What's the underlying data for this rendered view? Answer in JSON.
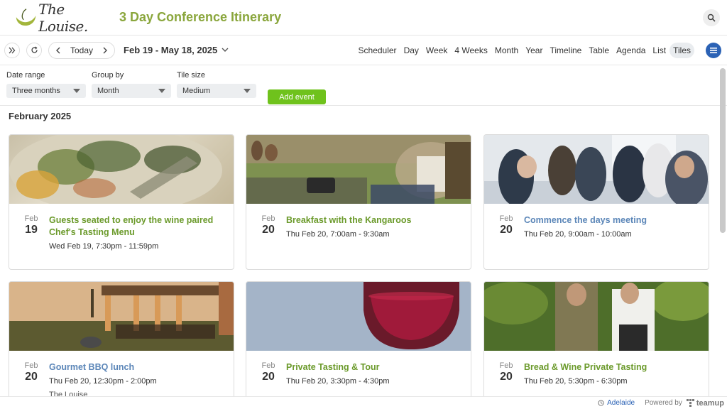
{
  "header": {
    "logo_text": "The Louise.",
    "title": "3 Day Conference Itinerary"
  },
  "toolbar": {
    "today_label": "Today",
    "date_range": "Feb 19 - May 18, 2025",
    "views": [
      "Scheduler",
      "Day",
      "Week",
      "4 Weeks",
      "Month",
      "Year",
      "Timeline",
      "Table",
      "Agenda",
      "List",
      "Tiles"
    ],
    "active_view": "Tiles"
  },
  "filters": {
    "date_range": {
      "label": "Date range",
      "value": "Three months"
    },
    "group_by": {
      "label": "Group by",
      "value": "Month"
    },
    "tile_size": {
      "label": "Tile size",
      "value": "Medium"
    },
    "add_event_label": "Add event"
  },
  "section_title": "February 2025",
  "events": [
    {
      "mon": "Feb",
      "day": "19",
      "title": "Guests seated to enjoy the wine paired Chef's Tasting Menu",
      "time": "Wed Feb 19, 7:30pm - 11:59pm",
      "location": "",
      "color": "#6b9a2b"
    },
    {
      "mon": "Feb",
      "day": "20",
      "title": "Breakfast with the Kangaroos",
      "time": "Thu Feb 20, 7:00am - 9:30am",
      "location": "",
      "color": "#6b9a2b"
    },
    {
      "mon": "Feb",
      "day": "20",
      "title": "Commence the days meeting",
      "time": "Thu Feb 20, 9:00am - 10:00am",
      "location": "",
      "color": "#5b86b8"
    },
    {
      "mon": "Feb",
      "day": "20",
      "title": "Gourmet BBQ lunch",
      "time": "Thu Feb 20, 12:30pm - 2:00pm",
      "location": "The Louise",
      "color": "#5b86b8"
    },
    {
      "mon": "Feb",
      "day": "20",
      "title": "Private Tasting & Tour",
      "time": "Thu Feb 20, 3:30pm - 4:30pm",
      "location": "",
      "color": "#6b9a2b"
    },
    {
      "mon": "Feb",
      "day": "20",
      "title": "Bread & Wine Private Tasting",
      "time": "Thu Feb 20, 5:30pm - 6:30pm",
      "location": "",
      "color": "#6b9a2b"
    }
  ],
  "footer": {
    "timezone": "Adelaide",
    "powered_by": "Powered by",
    "brand": "teamup"
  },
  "colors": {
    "title_green": "#8aa63c",
    "add_button": "#6fc21c",
    "menu_blue": "#2b62b5"
  }
}
